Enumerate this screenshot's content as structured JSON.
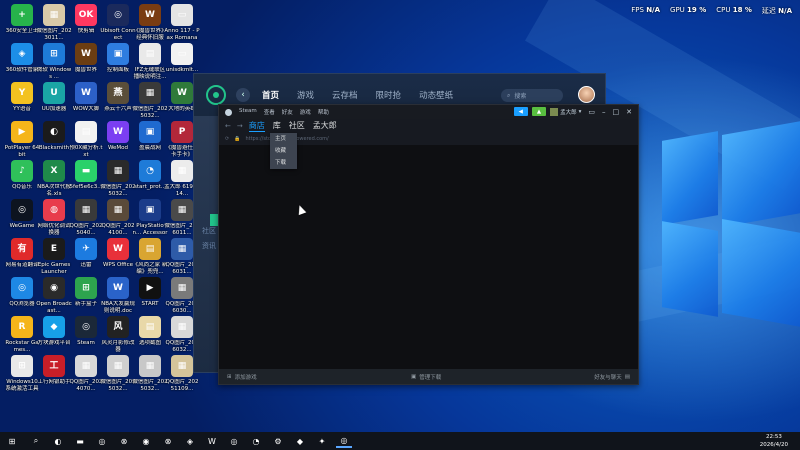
{
  "perf": [
    {
      "label": "FPS",
      "value": "N/A"
    },
    {
      "label": "GPU",
      "value": "19 %"
    },
    {
      "label": "CPU",
      "value": "18 %"
    },
    {
      "label": "延迟",
      "value": "N/A"
    }
  ],
  "desktop_icons": [
    {
      "label": "360安全卫士",
      "color": "#27b34b",
      "glyph": "+"
    },
    {
      "label": "微信图片_2023011...",
      "color": "#d8c9a8",
      "glyph": "▦"
    },
    {
      "label": "快剪辑",
      "color": "#ff3860",
      "glyph": "OK"
    },
    {
      "label": "Ubisoft Connect",
      "color": "#1b2a5c",
      "glyph": "◎"
    },
    {
      "label": "《魔兽世界》经典怀旧服",
      "color": "#7a3c12",
      "glyph": "W"
    },
    {
      "label": "Anno 117 - Pax Romana",
      "color": "#e4e4e4",
      "glyph": "▭"
    },
    {
      "label": "360软件管家",
      "color": "#1c8ee8",
      "glyph": "◈"
    },
    {
      "label": "微软 Windows ...",
      "color": "#1e7bd8",
      "glyph": "⊞"
    },
    {
      "label": "魔兽世界",
      "color": "#6b3d12",
      "glyph": "W"
    },
    {
      "label": "控制面板",
      "color": "#2e7de0",
      "glyph": "▣"
    },
    {
      "label": "IFZ无缝联区播映说明注...",
      "color": "#e9e9e9",
      "glyph": "▤"
    },
    {
      "label": "unisdkmlt...",
      "color": "#f2f2f2",
      "glyph": "▭"
    },
    {
      "label": "YY语音",
      "color": "#f3c220",
      "glyph": "Y"
    },
    {
      "label": "UU加速器",
      "color": "#1aa5a5",
      "glyph": "U"
    },
    {
      "label": "WOW大脚",
      "color": "#2c60c8",
      "glyph": "W"
    },
    {
      "label": "燕云十六声",
      "color": "#5a4e3a",
      "glyph": "燕"
    },
    {
      "label": "微信图片_2025032...",
      "color": "#3a3a3a",
      "glyph": "▦"
    },
    {
      "label": "大地的英雄",
      "color": "#2f7a3a",
      "glyph": "W"
    },
    {
      "label": "PotPlayer 64 bit",
      "color": "#f5b51a",
      "glyph": "▶"
    },
    {
      "label": "Blacksmith",
      "color": "#1b1b1b",
      "glyph": "◐"
    },
    {
      "label": "预0X藏分析.txt",
      "color": "#f2f2f2",
      "glyph": "▤"
    },
    {
      "label": "WeMod",
      "color": "#7b3ff2",
      "glyph": "W"
    },
    {
      "label": "盈晨战网",
      "color": "#1f6ad0",
      "glyph": "▣"
    },
    {
      "label": "《魔兽避任务 卡手卡》",
      "color": "#b3273a",
      "glyph": "P"
    },
    {
      "label": "QQ音乐",
      "color": "#2fc05a",
      "glyph": "♪"
    },
    {
      "label": "NBA次世代报名.xls",
      "color": "#1f8a4a",
      "glyph": "X"
    },
    {
      "label": "5fef5e6c3...",
      "color": "#2ad16a",
      "glyph": "▬"
    },
    {
      "label": "微信图片_2025032...",
      "color": "#2a2a2a",
      "glyph": "▦"
    },
    {
      "label": "start_prot...",
      "color": "#1e7bd8",
      "glyph": "◔"
    },
    {
      "label": "孟大郎 6190714...",
      "color": "#ececec",
      "glyph": "▦"
    },
    {
      "label": "WeGame",
      "color": "#0d1420",
      "glyph": "◎"
    },
    {
      "label": "网络优化调试换器",
      "color": "#e83c4c",
      "glyph": "◍"
    },
    {
      "label": "QQ图片_2025040...",
      "color": "#3a3a3a",
      "glyph": "▦"
    },
    {
      "label": "QQ图片_2024100...",
      "color": "#5a4a3a",
      "glyph": "▦"
    },
    {
      "label": "PlayStation... Accessories",
      "color": "#1b3c8a",
      "glyph": "▣"
    },
    {
      "label": "微信图片_2026011...",
      "color": "#4a4a4a",
      "glyph": "▦"
    },
    {
      "label": "网易有道翻译",
      "color": "#e02a2a",
      "glyph": "有"
    },
    {
      "label": "Epic Games Launcher",
      "color": "#1b1b1b",
      "glyph": "E"
    },
    {
      "label": "迅雷",
      "color": "#1c7be0",
      "glyph": "✈"
    },
    {
      "label": "WPS Office",
      "color": "#e8303a",
      "glyph": "W"
    },
    {
      "label": "《风尚之家 新编》兜兜...",
      "color": "#d9a531",
      "glyph": "▤"
    },
    {
      "label": "QQ图片_2026031...",
      "color": "#2e5ba8",
      "glyph": "▦"
    },
    {
      "label": "QQ浏览器",
      "color": "#1e88e5",
      "glyph": "◎"
    },
    {
      "label": "Open Broadcast...",
      "color": "#2a2a2a",
      "glyph": "◉"
    },
    {
      "label": "新手盒子",
      "color": "#2da44e",
      "glyph": "⊞"
    },
    {
      "label": "NBA大发赢规则说明.doc",
      "color": "#2a63c9",
      "glyph": "W"
    },
    {
      "label": "START",
      "color": "#111",
      "glyph": "▶"
    },
    {
      "label": "QQ图片_2026030...",
      "color": "#7a7a7a",
      "glyph": "▦"
    },
    {
      "label": "Rockstar Games...",
      "color": "#f5b51a",
      "glyph": "R"
    },
    {
      "label": "方块游戏平台",
      "color": "#17a0e8",
      "glyph": "◆"
    },
    {
      "label": "Steam",
      "color": "#1b2838",
      "glyph": "◎"
    },
    {
      "label": "风灵月影修改器",
      "color": "#222",
      "glyph": "风"
    },
    {
      "label": "选项截图",
      "color": "#e8d8a8",
      "glyph": "▤"
    },
    {
      "label": "QQ图片_2026032...",
      "color": "#d8d8d8",
      "glyph": "▦"
    },
    {
      "label": "Windows10系统激活工具",
      "color": "#e8e8e8",
      "glyph": "⊞"
    },
    {
      "label": "工行网银助手",
      "color": "#c81e28",
      "glyph": "工"
    },
    {
      "label": "QQ图片_2024070...",
      "color": "#d8d8d8",
      "glyph": "▦"
    },
    {
      "label": "微信图片_2025032...",
      "color": "#cfcfcf",
      "glyph": "▦"
    },
    {
      "label": "微信图片_2025032...",
      "color": "#c8c8c8",
      "glyph": "▦"
    },
    {
      "label": "QQ图片_20251109...",
      "color": "#d4c49a",
      "glyph": "▦"
    }
  ],
  "launcher": {
    "back_glyph": "‹",
    "tabs": [
      {
        "label": "首页",
        "active": true
      },
      {
        "label": "游戏",
        "active": false
      },
      {
        "label": "云存档",
        "active": false
      },
      {
        "label": "限时抢",
        "active": false
      },
      {
        "label": "动态壁纸",
        "active": false
      }
    ],
    "search_placeholder": "搜索",
    "side_items": [
      "社区",
      "资讯"
    ]
  },
  "steam": {
    "menu": [
      "Steam",
      "查看",
      "好友",
      "游戏",
      "帮助"
    ],
    "notif_label": "◀",
    "bell_label": "▲",
    "user": "孟大郎",
    "nav": {
      "back": "←",
      "forward": "→",
      "tabs": [
        {
          "label": "商店",
          "active": true
        },
        {
          "label": "库",
          "active": false
        },
        {
          "label": "社区",
          "active": false
        },
        {
          "label": "孟大郎",
          "active": false
        }
      ]
    },
    "url": "https://store.steampowered.com/",
    "dropdown": [
      "主页",
      "收藏",
      "下载"
    ],
    "footer": {
      "add_game": "添加游戏",
      "downloads": "管理下载",
      "friends": "好友与聊天"
    }
  },
  "taskbar": {
    "items": [
      {
        "name": "start-button",
        "glyph": "⊞"
      },
      {
        "name": "search-button",
        "glyph": "⌕"
      },
      {
        "name": "edge-app",
        "glyph": "◐"
      },
      {
        "name": "file-explorer-app",
        "glyph": "▬"
      },
      {
        "name": "ubisoft-app",
        "glyph": "◎"
      },
      {
        "name": "xbox-app",
        "glyph": "⊗"
      },
      {
        "name": "chrome-app",
        "glyph": "◉"
      },
      {
        "name": "xbox2-app",
        "glyph": "⊗"
      },
      {
        "name": "fengling-app",
        "glyph": "◈"
      },
      {
        "name": "wps-app",
        "glyph": "W"
      },
      {
        "name": "qq-browser-app",
        "glyph": "◎"
      },
      {
        "name": "qq-app",
        "glyph": "◔"
      },
      {
        "name": "settings-app",
        "glyph": "⚙"
      },
      {
        "name": "game-app",
        "glyph": "◆"
      },
      {
        "name": "uu-app",
        "glyph": "✦"
      },
      {
        "name": "steam-app",
        "glyph": "◎"
      }
    ],
    "time": "22:53",
    "date": "2026/4/20"
  }
}
